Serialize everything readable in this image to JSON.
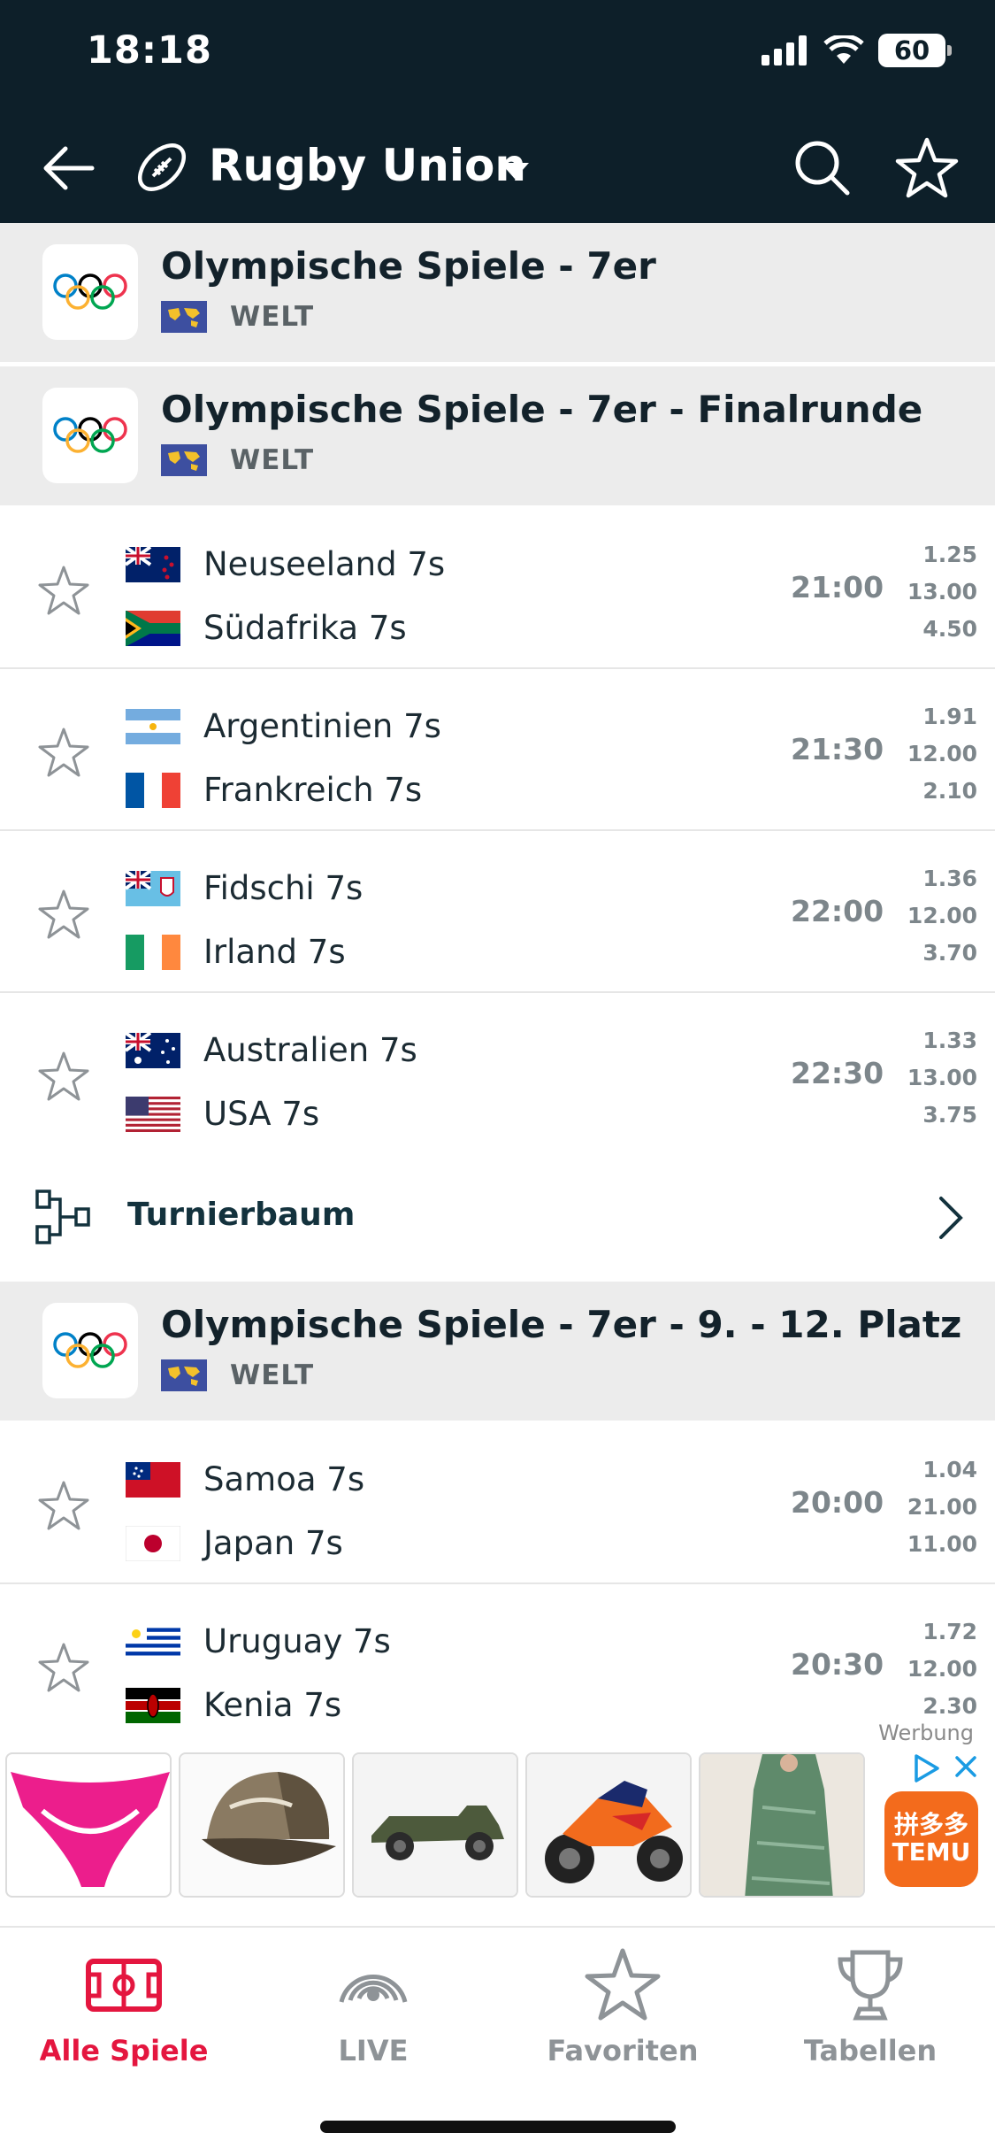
{
  "status_bar": {
    "time": "18:18",
    "battery": "60"
  },
  "header": {
    "sport_title": "Rugby Union",
    "icons": [
      "back-arrow-icon",
      "rugby-ball-icon",
      "caret-down-icon",
      "search-icon",
      "star-icon"
    ]
  },
  "competitions": [
    {
      "name": "Olympische Spiele - 7er",
      "region": "WELT"
    },
    {
      "name": "Olympische Spiele - 7er - Finalrunde",
      "region": "WELT"
    },
    {
      "name": "Olympische Spiele - 7er - 9. - 12. Platz",
      "region": "WELT"
    }
  ],
  "matches": [
    {
      "home": "Neuseeland 7s",
      "away": "Südafrika 7s",
      "time": "21:00",
      "odds": [
        "1.25",
        "13.00",
        "4.50"
      ]
    },
    {
      "home": "Argentinien 7s",
      "away": "Frankreich 7s",
      "time": "21:30",
      "odds": [
        "1.91",
        "12.00",
        "2.10"
      ]
    },
    {
      "home": "Fidschi 7s",
      "away": "Irland 7s",
      "time": "22:00",
      "odds": [
        "1.36",
        "12.00",
        "3.70"
      ]
    },
    {
      "home": "Australien 7s",
      "away": "USA 7s",
      "time": "22:30",
      "odds": [
        "1.33",
        "13.00",
        "3.75"
      ]
    },
    {
      "home": "Samoa 7s",
      "away": "Japan 7s",
      "time": "20:00",
      "odds": [
        "1.04",
        "21.00",
        "11.00"
      ]
    },
    {
      "home": "Uruguay 7s",
      "away": "Kenia 7s",
      "time": "20:30",
      "odds": [
        "1.72",
        "12.00",
        "2.30"
      ]
    }
  ],
  "bracket": {
    "label": "Turnierbaum"
  },
  "ad": {
    "label": "Werbung",
    "brand": "TEMU",
    "brand_glyphs": "拼多多"
  },
  "bottom_nav": [
    {
      "label": "Alle Spiele",
      "active": true
    },
    {
      "label": "LIVE",
      "active": false
    },
    {
      "label": "Favoriten",
      "active": false
    },
    {
      "label": "Tabellen",
      "active": false
    }
  ],
  "colors": {
    "header_bg": "#0d1f29",
    "accent": "#e4163f",
    "section_bg": "#ececec",
    "muted": "#7d868b"
  }
}
